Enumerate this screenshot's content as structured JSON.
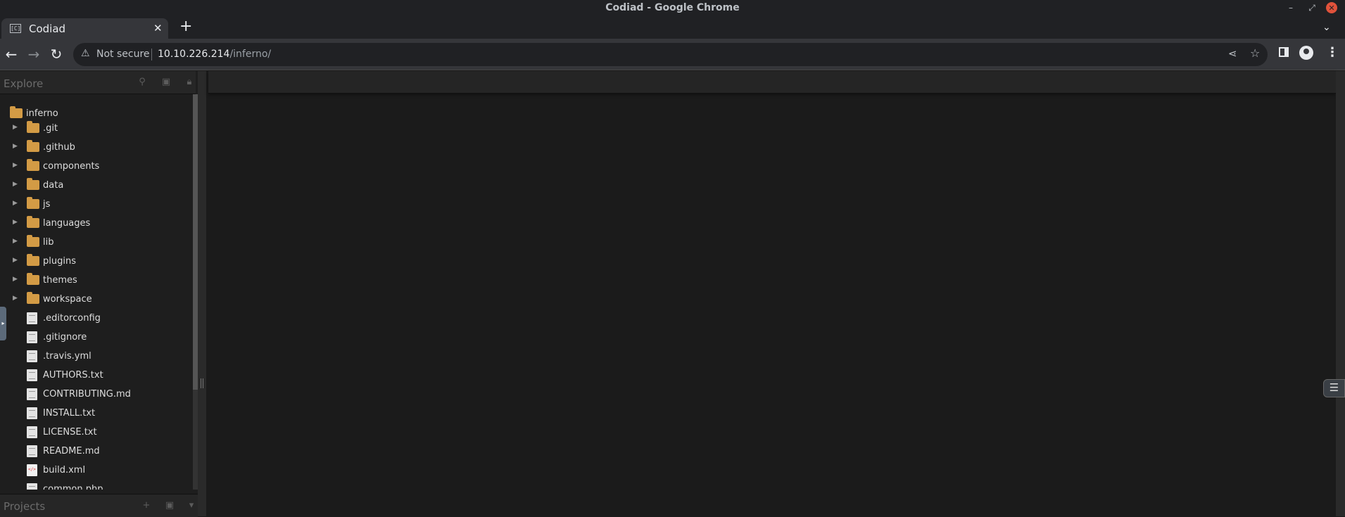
{
  "window": {
    "title": "Codiad - Google Chrome"
  },
  "tab": {
    "favicon_text": "[C]",
    "label": "Codiad"
  },
  "address_bar": {
    "security_label": "Not secure",
    "host": "10.10.226.214",
    "path": "/inferno/"
  },
  "sidebar": {
    "explore_label": "Explore",
    "projects_label": "Projects",
    "root_folder": "inferno",
    "folders": [
      ".git",
      ".github",
      "components",
      "data",
      "js",
      "languages",
      "lib",
      "plugins",
      "themes",
      "workspace"
    ],
    "files": [
      ".editorconfig",
      ".gitignore",
      ".travis.yml",
      "AUTHORS.txt",
      "CONTRIBUTING.md",
      "INSTALL.txt",
      "LICENSE.txt",
      "README.md",
      "build.xml",
      "common.php"
    ]
  },
  "colors": {
    "folder": "#d39b45",
    "background": "#1b1b1b",
    "chrome_frame": "#202124",
    "toolbar": "#35363a"
  },
  "icons": [
    "search-icon",
    "archive-icon",
    "lock-icon",
    "plus-icon",
    "chevron-down-icon",
    "folder-icon",
    "file-icon",
    "hamburger-icon"
  ]
}
